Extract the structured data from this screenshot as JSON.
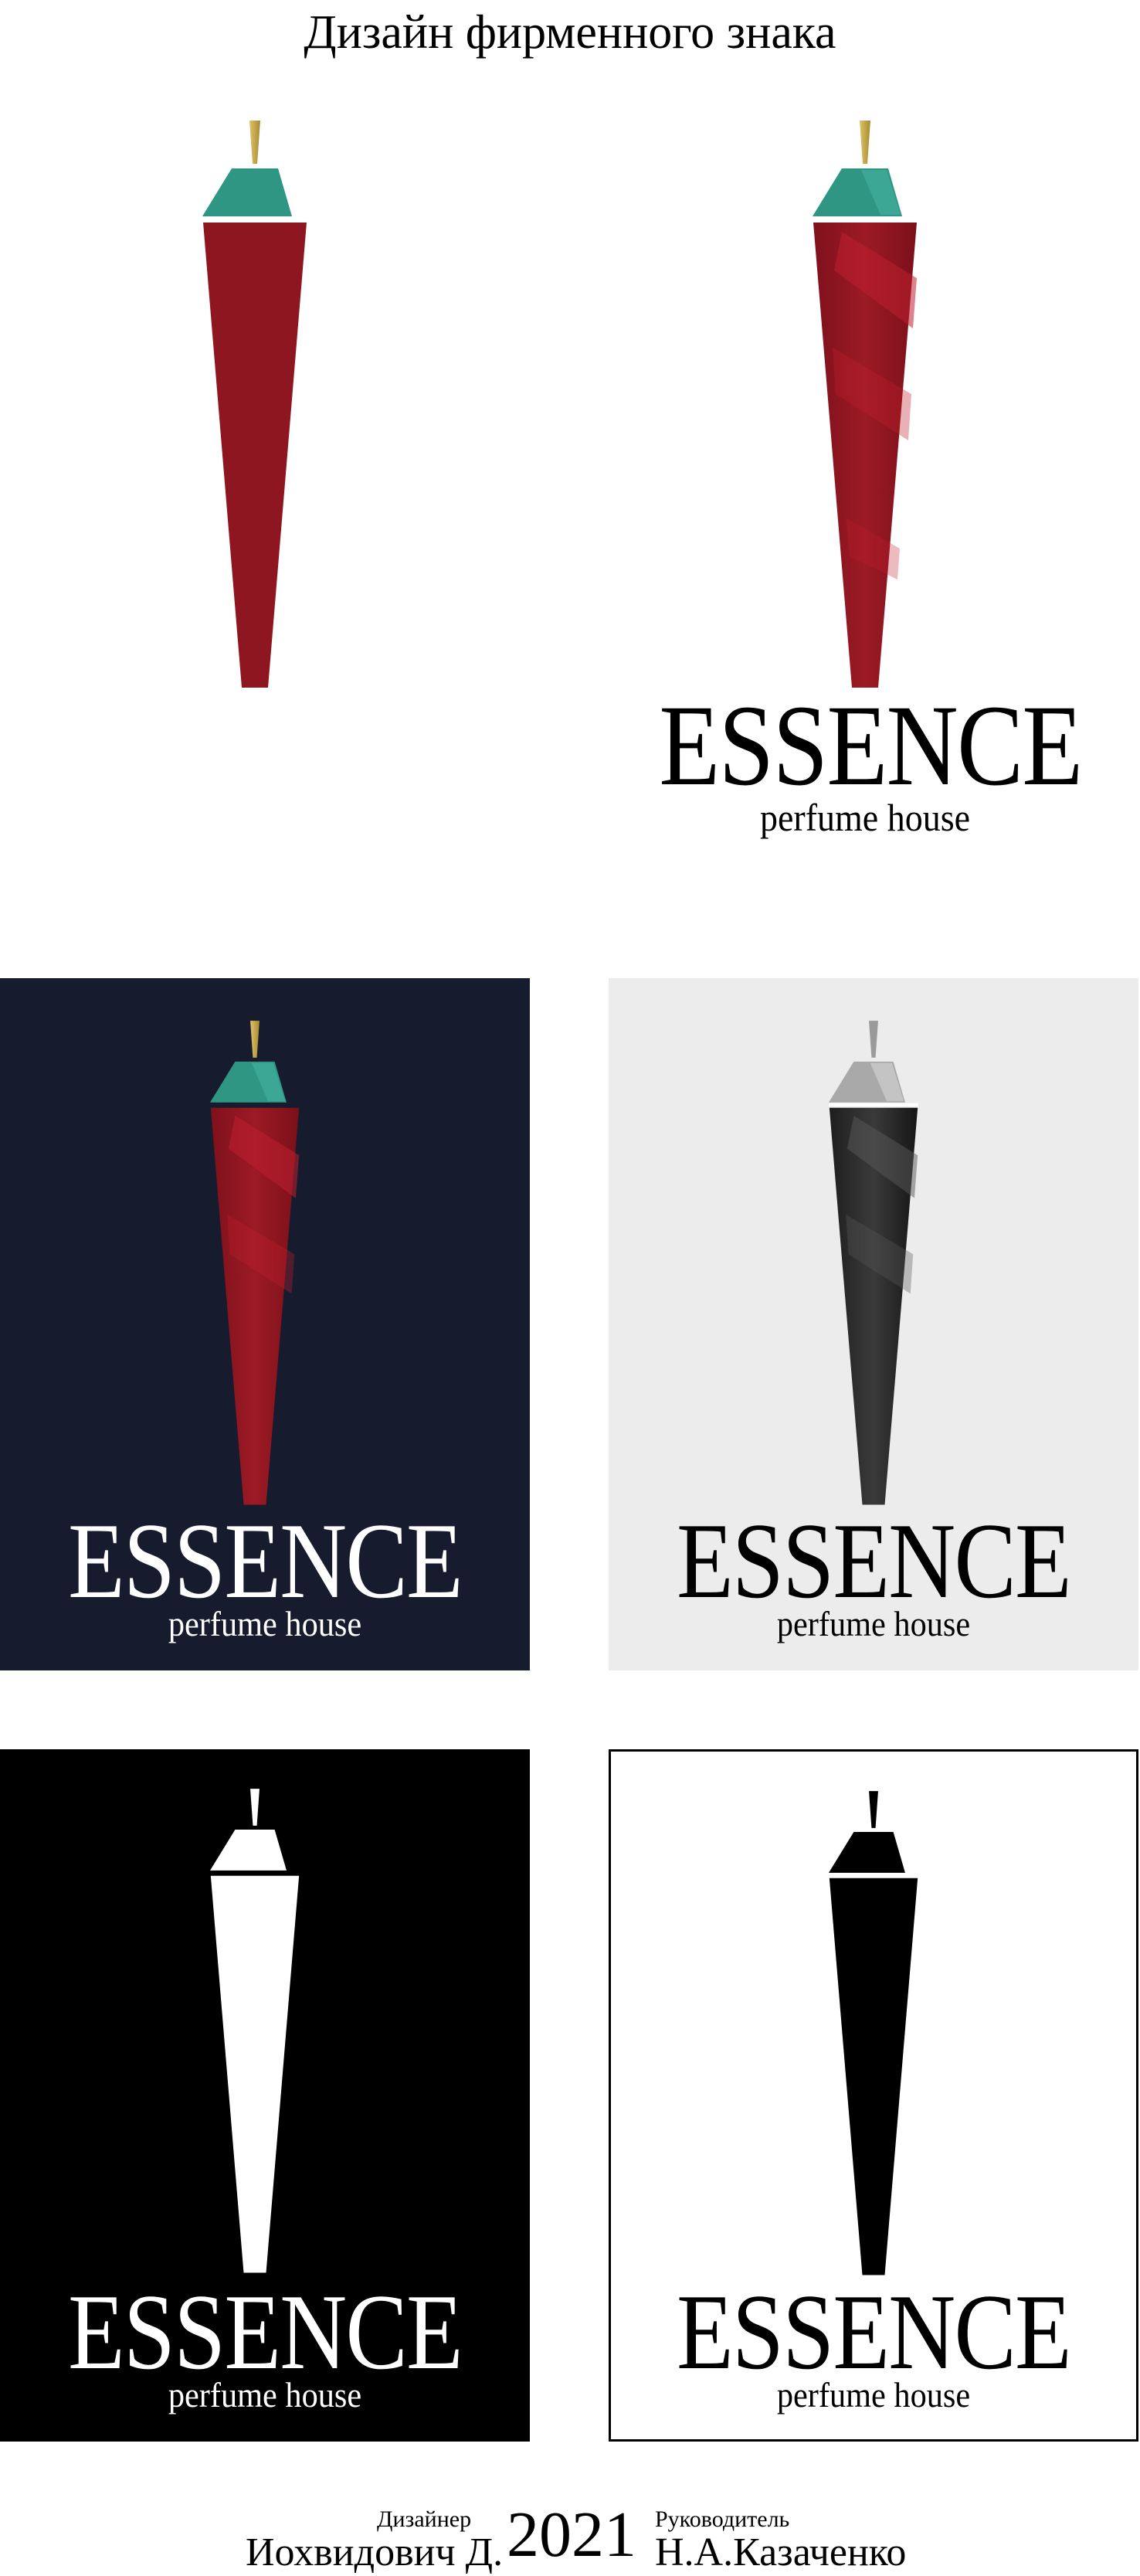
{
  "header": {
    "title": "Дизайн фирменного знака"
  },
  "logo": {
    "wordmark": "ESSENCE",
    "tagline": "perfume house"
  },
  "variants": [
    {
      "id": "mark-flat",
      "background": "#ffffff",
      "style": "flat-color",
      "has_text": false
    },
    {
      "id": "mark-faceted",
      "background": "#ffffff",
      "style": "faceted-color",
      "has_text": true
    },
    {
      "id": "on-navy",
      "background": "#171b2e",
      "style": "faceted-color",
      "has_text": true
    },
    {
      "id": "grayscale",
      "background": "#ececec",
      "style": "grayscale",
      "has_text": true
    },
    {
      "id": "inverse",
      "background": "#000000",
      "style": "white-silhouette",
      "has_text": true
    },
    {
      "id": "black-outline",
      "background": "#ffffff",
      "style": "black-silhouette",
      "has_text": true
    }
  ],
  "colors": {
    "bottle_red": "#8e1620",
    "bottle_red_light": "#b81c2b",
    "cap_teal": "#2f9683",
    "tip_gold": "#c9a84a",
    "navy": "#171b2e",
    "light_gray": "#ececec"
  },
  "footer": {
    "designer_label": "Дизайнер",
    "designer_name": "Иохвидович Д.",
    "year": "2021",
    "supervisor_label": "Руководитель",
    "supervisor_name": "Н.А.Казаченко"
  }
}
